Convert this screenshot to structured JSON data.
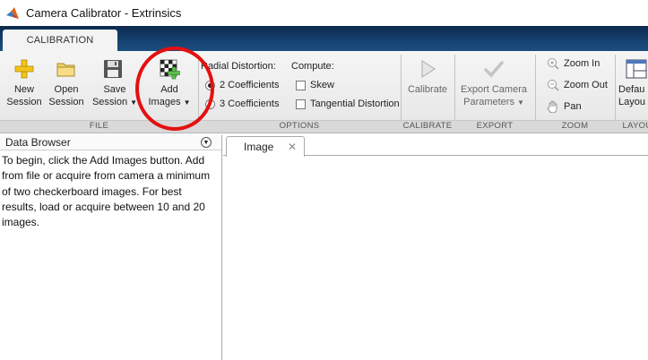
{
  "window": {
    "title": "Camera Calibrator - Extrinsics"
  },
  "tabs": {
    "calibration": "CALIBRATION"
  },
  "file": {
    "new_session": [
      "New",
      "Session"
    ],
    "open_session": [
      "Open",
      "Session"
    ],
    "save_session": [
      "Save",
      "Session"
    ],
    "add_images": [
      "Add",
      "Images"
    ],
    "label": "FILE"
  },
  "options": {
    "radial_label": "Radial Distortion:",
    "coeff2": "2 Coefficients",
    "coeff3": "3 Coefficients",
    "compute_label": "Compute:",
    "skew": "Skew",
    "tangential": "Tangential Distortion",
    "label": "OPTIONS"
  },
  "calibrate": {
    "button": "Calibrate",
    "label": "CALIBRATE"
  },
  "export": {
    "button": [
      "Export Camera",
      "Parameters"
    ],
    "label": "EXPORT"
  },
  "zoom": {
    "zoom_in": "Zoom In",
    "zoom_out": "Zoom Out",
    "pan": "Pan",
    "label": "ZOOM"
  },
  "layout": {
    "default_layout": [
      "Defau",
      "Layou"
    ],
    "label": "LAYOU"
  },
  "browser": {
    "title": "Data Browser",
    "instructions": "To begin, click the Add Images button. Add from file or acquire from camera a minimum of two checkerboard images. For best results, load or acquire between 10 and 20 images."
  },
  "image_panel": {
    "tab": "Image"
  },
  "colors": {
    "annotation": "#e41010",
    "tabstrip": "#15406e"
  }
}
